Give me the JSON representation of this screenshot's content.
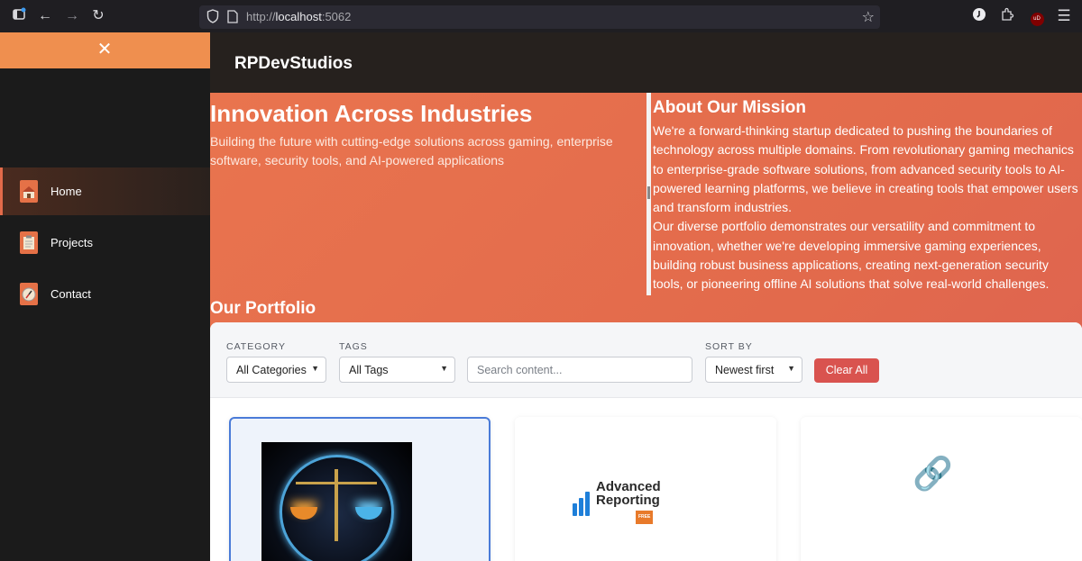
{
  "browser": {
    "url_prefix": "http://",
    "url_host": "localhost",
    "url_port": ":5062",
    "icons": [
      "sidebar-toggle-icon",
      "back-arrow-icon",
      "forward-arrow-icon",
      "reload-icon",
      "shield-icon",
      "page-icon",
      "star-icon",
      "account-icon",
      "extensions-icon",
      "ublock-icon",
      "menu-icon"
    ],
    "ublock_badge": "uD"
  },
  "sidebar": {
    "close_glyph": "✕",
    "items": [
      {
        "label": "Home",
        "icon": "home-icon",
        "active": true
      },
      {
        "label": "Projects",
        "icon": "clipboard-icon",
        "active": false
      },
      {
        "label": "Contact",
        "icon": "compass-icon",
        "active": false
      }
    ]
  },
  "header": {
    "brand": "RPDevStudios"
  },
  "hero": {
    "title": "Innovation Across Industries",
    "subtitle": "Building the future with cutting-edge solutions across gaming, enterprise software, security tools, and AI-powered applications",
    "about_title": "About Our Mission",
    "about_p1": "We're a forward-thinking startup dedicated to pushing the boundaries of technology across multiple domains. From revolutionary gaming mechanics to enterprise-grade software solutions, from advanced security tools to AI-powered learning platforms, we believe in creating tools that empower users and transform industries.",
    "about_p2": "Our diverse portfolio demonstrates our versatility and commitment to innovation, whether we're developing immersive gaming experiences, building robust business applications, creating next-generation security tools, or pioneering offline AI solutions that solve real-world challenges.",
    "portfolio_title": "Our Portfolio"
  },
  "filters": {
    "category_label": "CATEGORY",
    "category_value": "All Categories",
    "tags_label": "TAGS",
    "tags_value": "All Tags",
    "search_placeholder": "Search content...",
    "sort_label": "SORT BY",
    "sort_value": "Newest first",
    "clear_label": "Clear All"
  },
  "cards": [
    {
      "image": "scales-of-balance-artwork",
      "selected": true
    },
    {
      "image": "advanced-reporting-logo",
      "logo_line1": "Advanced",
      "logo_line2": "Reporting",
      "logo_badge": "FREE"
    },
    {
      "image": "link-icon",
      "glyph": "🔗"
    }
  ],
  "colors": {
    "accent": "#e9744e",
    "header_bg": "#26211e",
    "sidebar_bg": "#1b1b1b",
    "sidebar_top": "#ef8f4f",
    "clear_button": "#d9534f",
    "selected_border": "#4a7bd8"
  }
}
